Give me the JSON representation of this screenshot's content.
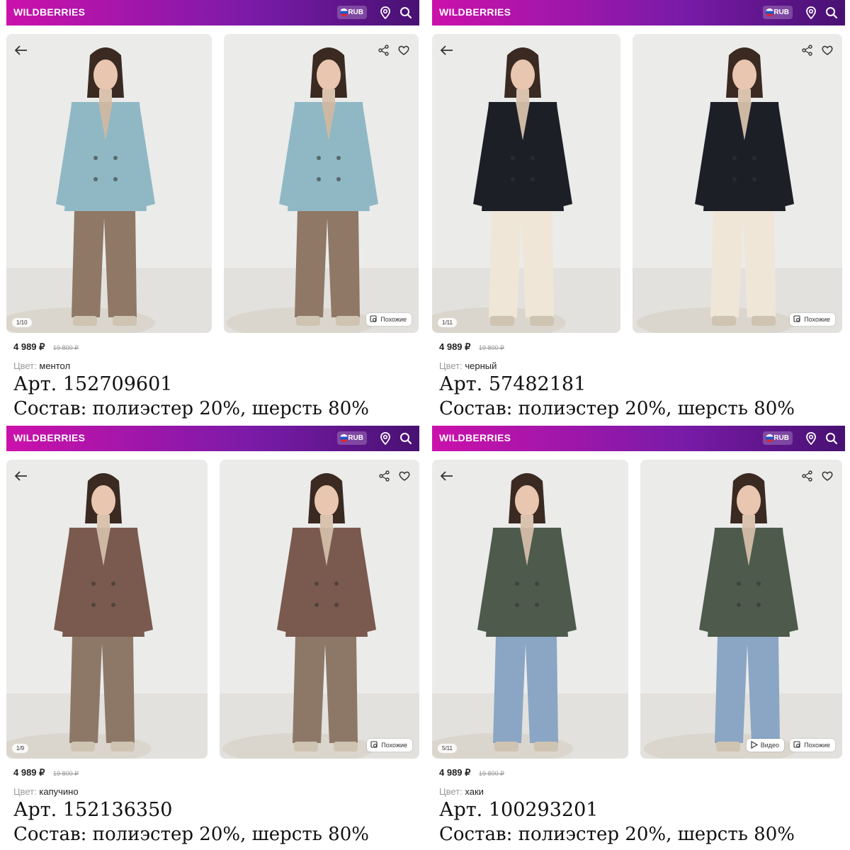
{
  "colors": {
    "brand_start": "#cb11ab",
    "brand_end": "#481173"
  },
  "panels": [
    {
      "brand": "WILDBERRIES",
      "currency": "RUB",
      "counter": "1/10",
      "similar_label": "Похожие",
      "video_label": "",
      "price": "4 989 ₽",
      "old_price": "19 800 ₽",
      "color_label": "Цвет:",
      "color_value": "ментол",
      "article": "Арт. 152709601",
      "composition": "Состав: полиэстер 20%,  шерсть 80%",
      "coat_color": "#8fb8c4",
      "pants_color": "#8f7866"
    },
    {
      "brand": "WILDBERRIES",
      "currency": "RUB",
      "counter": "1/11",
      "similar_label": "Похожие",
      "video_label": "",
      "price": "4 989 ₽",
      "old_price": "19 800 ₽",
      "color_label": "Цвет:",
      "color_value": "черный",
      "article": "Арт. 57482181",
      "composition": "Состав: полиэстер 20%,  шерсть 80%",
      "coat_color": "#1c1f26",
      "pants_color": "#efe6d8"
    },
    {
      "brand": "WILDBERRIES",
      "currency": "RUB",
      "counter": "1/9",
      "similar_label": "Похожие",
      "video_label": "",
      "price": "4 989 ₽",
      "old_price": "19 800 ₽",
      "color_label": "Цвет:",
      "color_value": "капучино",
      "article": "Арт. 152136350",
      "composition": "Состав: полиэстер 20%,  шерсть 80%",
      "coat_color": "#7a5a4e",
      "pants_color": "#8d7868"
    },
    {
      "brand": "WILDBERRIES",
      "currency": "RUB",
      "counter": "5/11",
      "similar_label": "Похожие",
      "video_label": "Видео",
      "price": "4 989 ₽",
      "old_price": "19 800 ₽",
      "color_label": "Цвет:",
      "color_value": "хаки",
      "article": "Арт. 100293201",
      "composition": "Состав: полиэстер 20%,  шерсть 80%",
      "coat_color": "#4d5a4c",
      "pants_color": "#8aa6c4"
    }
  ]
}
